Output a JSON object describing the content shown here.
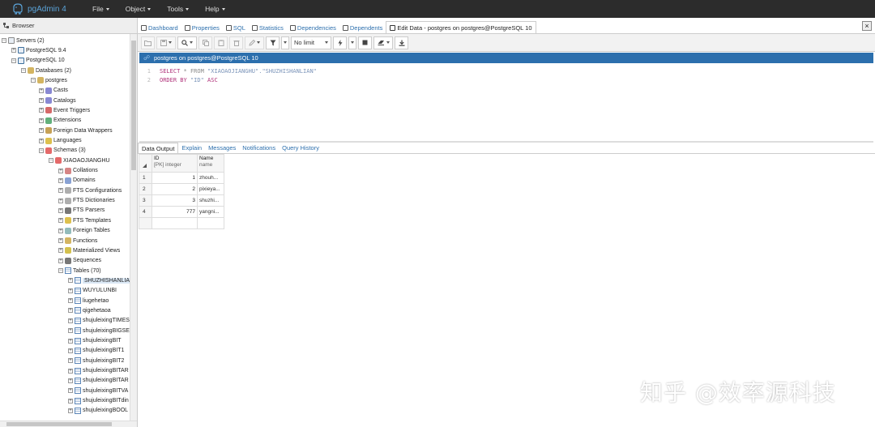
{
  "app": {
    "title": "pgAdmin 4"
  },
  "menu": [
    {
      "label": "File"
    },
    {
      "label": "Object"
    },
    {
      "label": "Tools"
    },
    {
      "label": "Help"
    }
  ],
  "browser": {
    "title": "Browser",
    "tree": [
      {
        "label": "Servers (2)",
        "icon": "servers-icon",
        "exp": "−"
      },
      {
        "label": "PostgreSQL 9.4",
        "icon": "server-icon",
        "exp": "+"
      },
      {
        "label": "PostgreSQL 10",
        "icon": "server-icon",
        "exp": "−"
      },
      {
        "label": "Databases (2)",
        "icon": "databases-icon",
        "exp": "−"
      },
      {
        "label": "postgres",
        "icon": "database-icon",
        "exp": "−"
      },
      {
        "label": "Casts",
        "icon": "casts-icon",
        "exp": "+"
      },
      {
        "label": "Catalogs",
        "icon": "catalogs-icon",
        "exp": "+"
      },
      {
        "label": "Event Triggers",
        "icon": "event-triggers-icon",
        "exp": "+"
      },
      {
        "label": "Extensions",
        "icon": "extensions-icon",
        "exp": "+"
      },
      {
        "label": "Foreign Data Wrappers",
        "icon": "fdw-icon",
        "exp": "+"
      },
      {
        "label": "Languages",
        "icon": "languages-icon",
        "exp": "+"
      },
      {
        "label": "Schemas (3)",
        "icon": "schemas-icon",
        "exp": "−"
      },
      {
        "label": "XIAOAOJIANGHU",
        "icon": "schema-icon",
        "exp": "−"
      },
      {
        "label": "Collations",
        "icon": "collations-icon",
        "exp": "+"
      },
      {
        "label": "Domains",
        "icon": "domains-icon",
        "exp": "+"
      },
      {
        "label": "FTS Configurations",
        "icon": "fts-config-icon",
        "exp": "+"
      },
      {
        "label": "FTS Dictionaries",
        "icon": "fts-dict-icon",
        "exp": "+"
      },
      {
        "label": "FTS Parsers",
        "icon": "fts-parser-icon",
        "exp": "+"
      },
      {
        "label": "FTS Templates",
        "icon": "fts-template-icon",
        "exp": "+"
      },
      {
        "label": "Foreign Tables",
        "icon": "foreign-tables-icon",
        "exp": "+"
      },
      {
        "label": "Functions",
        "icon": "functions-icon",
        "exp": "+"
      },
      {
        "label": "Materialized Views",
        "icon": "mviews-icon",
        "exp": "+"
      },
      {
        "label": "Sequences",
        "icon": "sequences-icon",
        "exp": "+"
      },
      {
        "label": "Tables (70)",
        "icon": "tables-icon",
        "exp": "−"
      },
      {
        "label": "SHUZHISHANLIAN",
        "icon": "table-icon",
        "exp": "+",
        "selected": true
      },
      {
        "label": "WUYULUNBI",
        "icon": "table-icon",
        "exp": "+"
      },
      {
        "label": "liugehetao",
        "icon": "table-icon",
        "exp": "+"
      },
      {
        "label": "qigehetaoa",
        "icon": "table-icon",
        "exp": "+"
      },
      {
        "label": "shujuleixingTIMES",
        "icon": "table-icon",
        "exp": "+"
      },
      {
        "label": "shujuleixingBIGSE",
        "icon": "table-icon",
        "exp": "+"
      },
      {
        "label": "shujuleixingBIT",
        "icon": "table-icon",
        "exp": "+"
      },
      {
        "label": "shujuleixingBIT1",
        "icon": "table-icon",
        "exp": "+"
      },
      {
        "label": "shujuleixingBIT2",
        "icon": "table-icon",
        "exp": "+"
      },
      {
        "label": "shujuleixingBITAR",
        "icon": "table-icon",
        "exp": "+"
      },
      {
        "label": "shujuleixingBITAR",
        "icon": "table-icon",
        "exp": "+"
      },
      {
        "label": "shujuleixingBITVA",
        "icon": "table-icon",
        "exp": "+"
      },
      {
        "label": "shujuleixingBITdin",
        "icon": "table-icon",
        "exp": "+"
      },
      {
        "label": "shujuleixingBOOL",
        "icon": "table-icon",
        "exp": "+"
      }
    ]
  },
  "tabs": [
    {
      "label": "Dashboard",
      "icon": "dashboard-icon"
    },
    {
      "label": "Properties",
      "icon": "properties-icon"
    },
    {
      "label": "SQL",
      "icon": "sql-icon"
    },
    {
      "label": "Statistics",
      "icon": "statistics-icon"
    },
    {
      "label": "Dependencies",
      "icon": "dependencies-icon"
    },
    {
      "label": "Dependents",
      "icon": "dependents-icon"
    },
    {
      "label": "Edit Data - postgres on postgres@PostgreSQL 10",
      "icon": "edit-data-icon",
      "active": true
    }
  ],
  "toolbar": {
    "limit_value": "No limit",
    "close_glyph": "×"
  },
  "connection": {
    "label": "postgres on postgres@PostgreSQL 10"
  },
  "editor": {
    "lines": [
      {
        "num": "1",
        "kw": "SELECT",
        "rest": " * FROM ",
        "str": "\"XIAOAOJIANGHU\".\"SHUZHISHANLIAN\"",
        "tail": ""
      },
      {
        "num": "2",
        "kw": "ORDER BY",
        "rest": " ",
        "str": "\"ID\"",
        "tail": " ASC"
      }
    ]
  },
  "output_tabs": [
    {
      "label": "Data Output",
      "active": true
    },
    {
      "label": "Explain"
    },
    {
      "label": "Messages"
    },
    {
      "label": "Notifications"
    },
    {
      "label": "Query History"
    }
  ],
  "grid": {
    "columns": [
      {
        "name": "ID",
        "type": "[PK] integer"
      },
      {
        "name": "Name",
        "type": "name"
      }
    ],
    "rows": [
      {
        "n": "1",
        "id": "1",
        "name": "zhouh..."
      },
      {
        "n": "2",
        "id": "2",
        "name": "pixieya..."
      },
      {
        "n": "3",
        "id": "3",
        "name": "shuzhi..."
      },
      {
        "n": "4",
        "id": "777",
        "name": "yangni..."
      }
    ]
  },
  "watermark": {
    "text": "知乎 @效率源科技"
  },
  "colors": {
    "accent": "#2c6fad",
    "navbar": "#2c2c2c",
    "keyword": "#b0327a"
  }
}
